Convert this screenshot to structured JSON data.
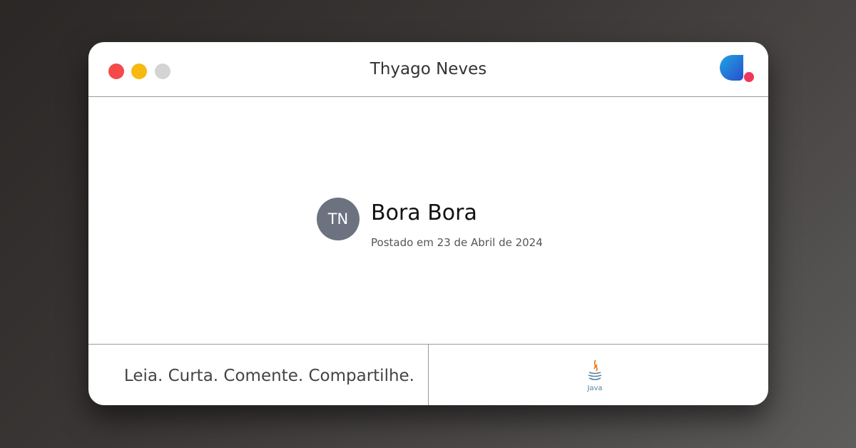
{
  "window": {
    "title": "Thyago Neves",
    "controls": [
      "close",
      "minimize",
      "maximize"
    ],
    "brand_icon": "site-logo-icon"
  },
  "post": {
    "avatar_initials": "TN",
    "title": "Bora Bora",
    "date": "Postado em 23 de Abril de 2024"
  },
  "footer": {
    "tagline": "Leia. Curta. Comente. Compartilhe.",
    "tag_icon": "java-icon",
    "tag_label": "Java"
  },
  "colors": {
    "close": "#f44a4a",
    "minimize": "#f5b912",
    "maximize": "#d4d4d4",
    "avatar_bg": "#6c7280",
    "brand_blue": "#1e7fd8",
    "brand_pink": "#f0365c",
    "java_orange": "#e76f00",
    "java_blue": "#5382a1"
  }
}
